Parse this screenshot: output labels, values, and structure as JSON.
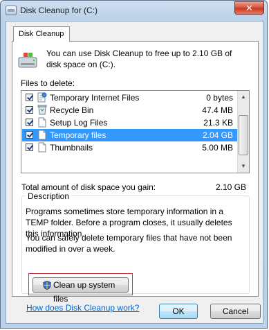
{
  "window": {
    "title": "Disk Cleanup for  (C:)",
    "close_label": "✕"
  },
  "tab": {
    "label": "Disk Cleanup"
  },
  "intro": {
    "text": "You can use Disk Cleanup to free up to 2.10 GB of disk space on  (C:)."
  },
  "files_to_delete": {
    "label": "Files to delete:",
    "items": [
      {
        "name": "Temporary Internet Files",
        "size": "0 bytes",
        "checked": true,
        "selected": false,
        "icon": "internet-files-icon"
      },
      {
        "name": "Recycle Bin",
        "size": "47.4 MB",
        "checked": true,
        "selected": false,
        "icon": "recycle-bin-icon"
      },
      {
        "name": "Setup Log Files",
        "size": "21.3 KB",
        "checked": true,
        "selected": false,
        "icon": "document-icon"
      },
      {
        "name": "Temporary files",
        "size": "2.04 GB",
        "checked": true,
        "selected": true,
        "icon": "document-icon"
      },
      {
        "name": "Thumbnails",
        "size": "5.00 MB",
        "checked": true,
        "selected": false,
        "icon": "document-icon"
      }
    ]
  },
  "total": {
    "label": "Total amount of disk space you gain:",
    "value": "2.10 GB"
  },
  "description": {
    "title": "Description",
    "para1": "Programs sometimes store temporary information in a TEMP folder. Before a program closes, it usually deletes this information.",
    "para2": "You can safely delete temporary files that have not been modified in over a week."
  },
  "buttons": {
    "cleanup_system": "Clean up system files",
    "ok": "OK",
    "cancel": "Cancel"
  },
  "help_link": "How does Disk Cleanup work?",
  "colors": {
    "selection": "#3399ff",
    "link": "#0066cc",
    "highlight_border": "#c13a43"
  }
}
